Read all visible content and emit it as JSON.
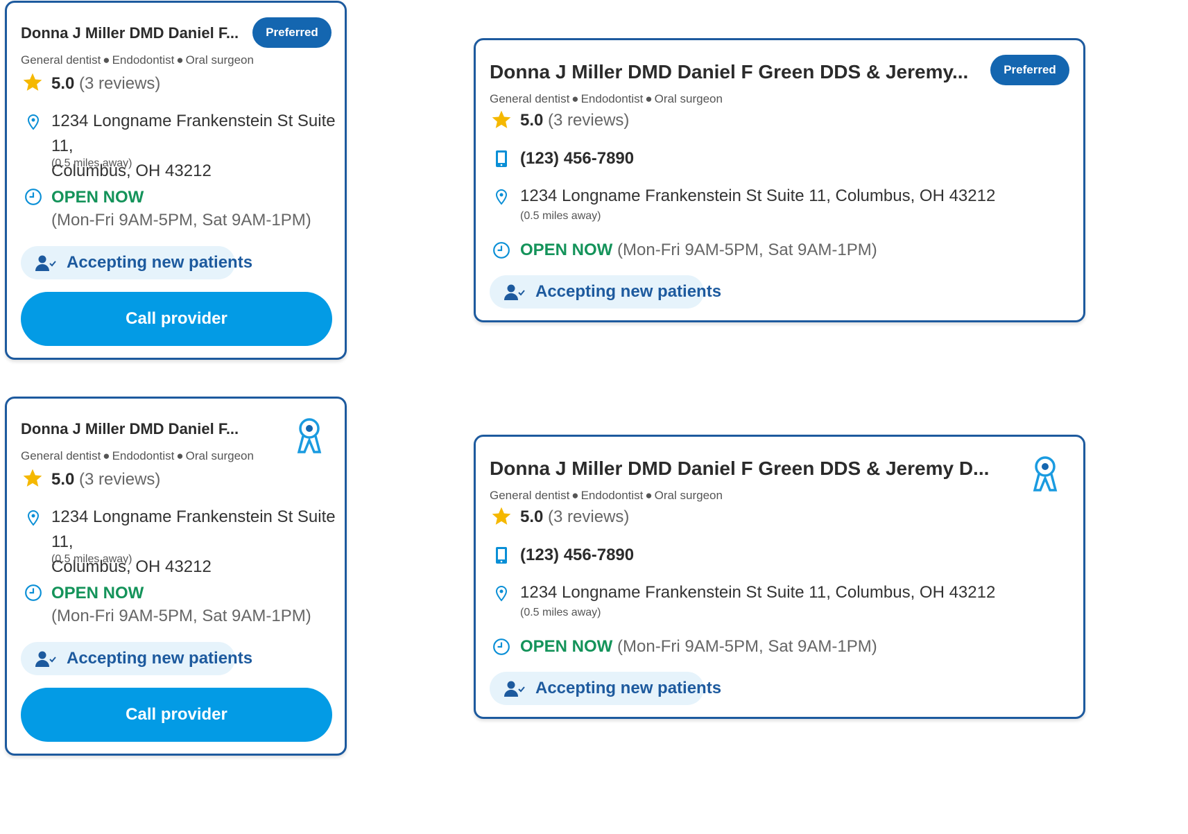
{
  "provider": {
    "name_short": "Donna J Miller DMD Daniel F...",
    "name_medium": "Donna J Miller DMD Daniel F Green DDS & Jeremy...",
    "name_long": "Donna J Miller DMD Daniel F Green DDS & Jeremy D...",
    "specialties": [
      "General dentist",
      "Endodontist",
      "Oral surgeon"
    ],
    "rating": "5.0",
    "reviews": "(3 reviews)",
    "phone": "(123) 456-7890",
    "address_line1": "1234 Longname Frankenstein St Suite 11,",
    "address_line2": "Columbus, OH 43212",
    "address_full": "1234 Longname Frankenstein St Suite 11, Columbus, OH 43212",
    "distance": "(0.5 miles away)",
    "open_status": "OPEN NOW",
    "hours": "(Mon-Fri 9AM-5PM, Sat 9AM-1PM)",
    "accepting": "Accepting new patients"
  },
  "labels": {
    "preferred": "Preferred",
    "call": "Call provider"
  },
  "icons": {
    "star": "star-icon",
    "location": "location-pin-icon",
    "clock": "clock-icon",
    "phone": "mobile-phone-icon",
    "person": "person-check-icon",
    "award": "award-ribbon-icon"
  },
  "colors": {
    "border": "#1d5a9e",
    "badge": "#1466b0",
    "cta": "#039be5",
    "open": "#14935a",
    "pill_bg": "#e6f3fb",
    "star": "#f5b800"
  }
}
